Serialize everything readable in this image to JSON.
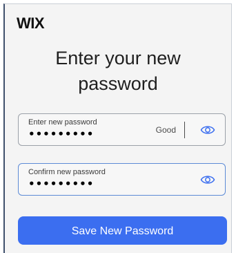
{
  "brand": {
    "logo_text": "WIX"
  },
  "heading": {
    "line1": "Enter your new",
    "line2": "password"
  },
  "new_password": {
    "label": "Enter new password",
    "value": "•••••••••",
    "strength": "Good",
    "icon": "eye-icon"
  },
  "confirm_password": {
    "label": "Confirm new password",
    "value": "•••••••••",
    "icon": "eye-icon"
  },
  "actions": {
    "save_label": "Save New Password"
  },
  "colors": {
    "accent": "#3b6ef0",
    "focus_border": "#5b8ad6",
    "icon": "#3b6ef0"
  }
}
